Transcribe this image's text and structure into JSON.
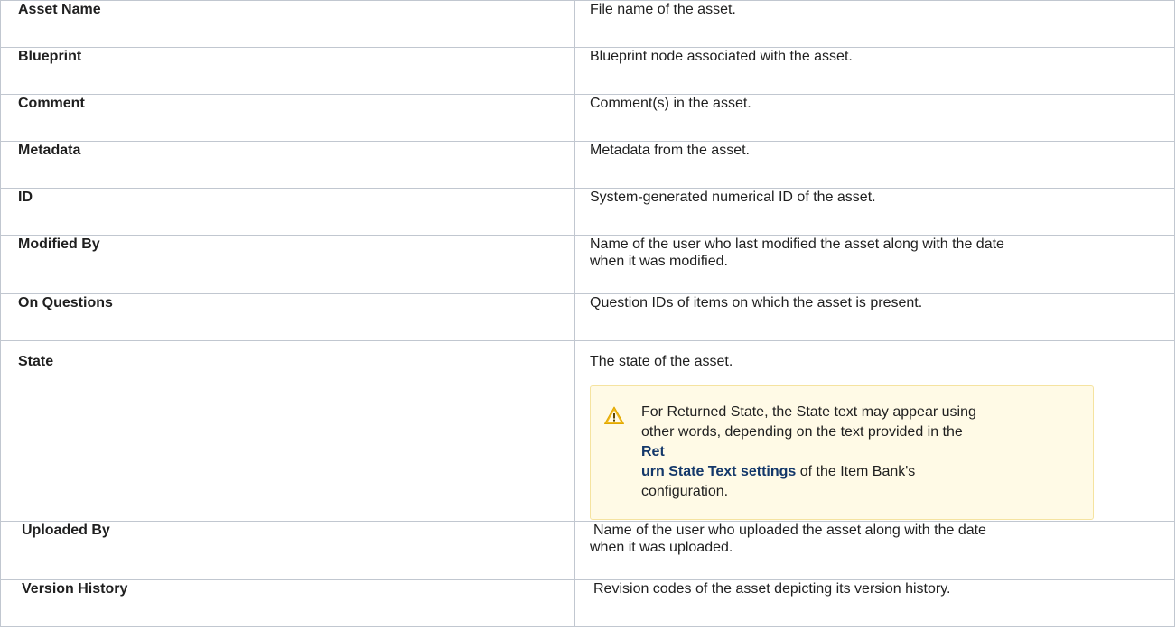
{
  "rows": [
    {
      "field": "Asset Name",
      "description": "File name of the asset."
    },
    {
      "field": "Blueprint",
      "description": "Blueprint node associated with the asset."
    },
    {
      "field": "Comment",
      "description": "Comment(s) in the asset."
    },
    {
      "field": "Metadata",
      "description": "Metadata from the asset."
    },
    {
      "field": "ID",
      "description": "System-generated numerical ID of the asset."
    },
    {
      "field": "Modified By",
      "description_line1": "Name of the user who last modified the asset along with the date",
      "description_line2": "when it was modified."
    },
    {
      "field": "On Questions",
      "description": "Question IDs of items on which the asset is present."
    },
    {
      "field": "State",
      "description": "The state of the asset."
    },
    {
      "field": "Uploaded By",
      "description_line1": "Name of the user who uploaded the asset along with the date",
      "description_line2": "when it was uploaded."
    },
    {
      "field": "Version History",
      "description": "Revision codes of the asset depicting its version history."
    }
  ],
  "warning": {
    "icon": "warning-triangle-icon",
    "line1": "For Returned State, the State text may appear using",
    "line2": "other words, depending on the text provided in the",
    "link_part1": "Ret",
    "link_part2": "urn State Text settings",
    "after_link": " of the Item Bank's",
    "line5": "configuration."
  },
  "colors": {
    "border": "#c1c7d0",
    "warning_bg": "#fffae6",
    "warning_border": "#f5e3a0",
    "link": "#14386a"
  }
}
